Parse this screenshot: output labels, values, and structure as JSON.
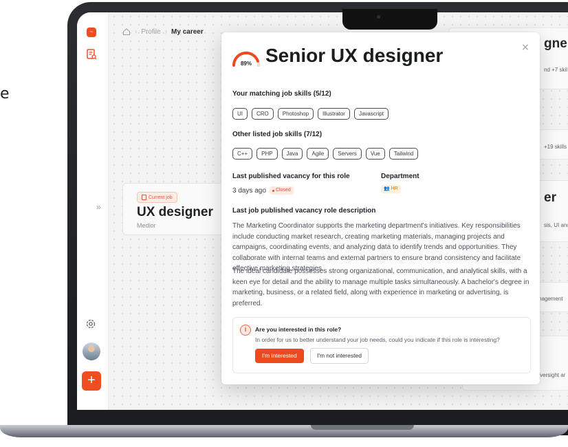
{
  "page_edge": {
    "char": "e"
  },
  "breadcrumb": {
    "items": [
      "Profile",
      "My career"
    ]
  },
  "sidebar": {
    "logo_glyph": "~",
    "add_glyph": "+",
    "expand_glyph": "»"
  },
  "current_job": {
    "badge": "Current job",
    "title": "UX designer",
    "level": "Medior"
  },
  "background_cards": {
    "top_title": "gner",
    "top_sub": "nd +7 skil",
    "skills_more": "+19 skills",
    "mid_title": "er",
    "mid_sub": "sis, UI and",
    "lower_text": "nagement",
    "bottom_text": "versight ar"
  },
  "modal": {
    "match_percent": "89%",
    "match_value": 0.89,
    "title": "Senior UX designer",
    "close_glyph": "×",
    "matching_label": "Your matching job skills (5/12)",
    "matching_skills": [
      "UI",
      "CRO",
      "Photoshop",
      "Illustrator",
      "Javascript"
    ],
    "other_label": "Other listed job skills (7/12)",
    "other_skills": [
      "C++",
      "PHP",
      "Java",
      "Agile",
      "Servers",
      "Vue",
      "Tailwind"
    ],
    "vacancy_label": "Last published vacancy for this role",
    "vacancy_value": "3 days ago",
    "vacancy_status": "Closed",
    "department_label": "Department",
    "department_value": "HR",
    "description_label": "Last job published vacancy role description",
    "description_p1": "The Marketing Coordinator supports the marketing department's initiatives. Key responsibilities include conducting market research, creating marketing materials, managing projects and campaigns, coordinating events, and analyzing data to identify trends and opportunities. They collaborate with internal teams and external partners to ensure brand consistency and facilitate effective marketing strategies.",
    "description_p2": "The ideal candidate possesses strong organizational, communication, and analytical skills, with a keen eye for detail and the ability to manage multiple tasks simultaneously. A bachelor's degree in marketing, business, or a related field, along with experience in marketing or advertising, is preferred.",
    "interest": {
      "question": "Are you interested in this role?",
      "subtitle": "In order for us to better understand your job needs, could you indicate if this role is interesting?",
      "yes_label": "I'm interested",
      "no_label": "I'm not interested"
    }
  },
  "colors": {
    "accent": "#ec4a1d",
    "closed": "#e0502f",
    "hr": "#c7791c"
  }
}
